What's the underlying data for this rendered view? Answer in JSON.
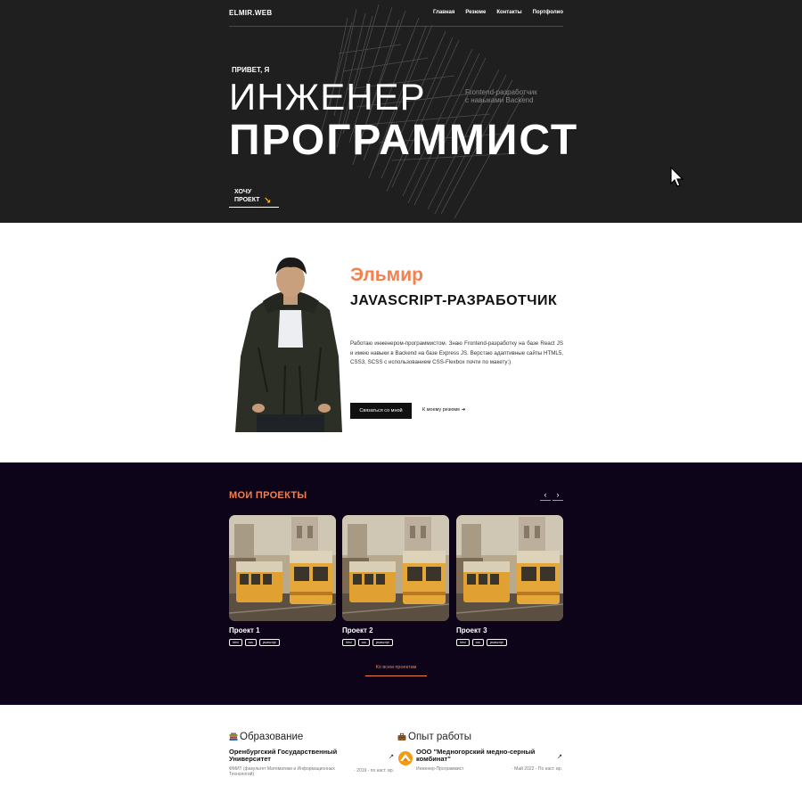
{
  "nav": {
    "logo": "ELMIR.WEB",
    "links": [
      "Главная",
      "Резюме",
      "Контакты",
      "Портфолио"
    ]
  },
  "hero": {
    "greeting": "ПРИВЕТ, Я",
    "line1": "ИНЖЕНЕР",
    "line2": "ПРОГРАММИСТ",
    "subtitle_line1": "Frontend-разработчик",
    "subtitle_line2": "с навыками Backend",
    "cta_line1": "ХОЧУ",
    "cta_line2": "ПРОЕКТ",
    "cta_arrow": "↘"
  },
  "about": {
    "name": "Эльмир",
    "role": "JAVASCRIPT-РАЗРАБОТЧИК",
    "bio": "Работаю инженером-программистом. Знаю Frontend-разработку на базе React JS и имею навыки в Backend на базе Express JS. Верстаю адаптивные сайты HTML5, CSS3, SCSS с использованием CSS-Flexbox почти по макету:)",
    "contact_button": "Связаться со мной",
    "resume_link": "К моему резюме ➔"
  },
  "projects": {
    "title": "МОИ ПРОЕКТЫ",
    "prev": "‹",
    "next": "›",
    "items": [
      {
        "name": "Проект 1",
        "tags": [
          "html",
          "css",
          "javascript"
        ]
      },
      {
        "name": "Проект 2",
        "tags": [
          "html",
          "css",
          "javascript"
        ]
      },
      {
        "name": "Проект 3",
        "tags": [
          "html",
          "css",
          "javascript"
        ]
      }
    ],
    "all_link": "Ко всем проектам"
  },
  "education": {
    "title": "Образование",
    "org": "Оренбургский Государственный Университет",
    "detail": "ФМИТ (факультет Математики и Информационных Технологий)",
    "date": "· 2019 - по наст. вр.",
    "ext": "↗"
  },
  "experience": {
    "title": "Опыт работы",
    "org": "ООО \"Медногорский медно-серный комбинат\"",
    "detail": "Инженер-Программист",
    "date": "· Май 2022 - По наст. вр.",
    "ext": "↗"
  },
  "colors": {
    "hero_bg": "#1f1f1f",
    "accent": "#f47f4f",
    "projects_bg": "#0d0419",
    "cta_arrow": "#f2b22b"
  }
}
